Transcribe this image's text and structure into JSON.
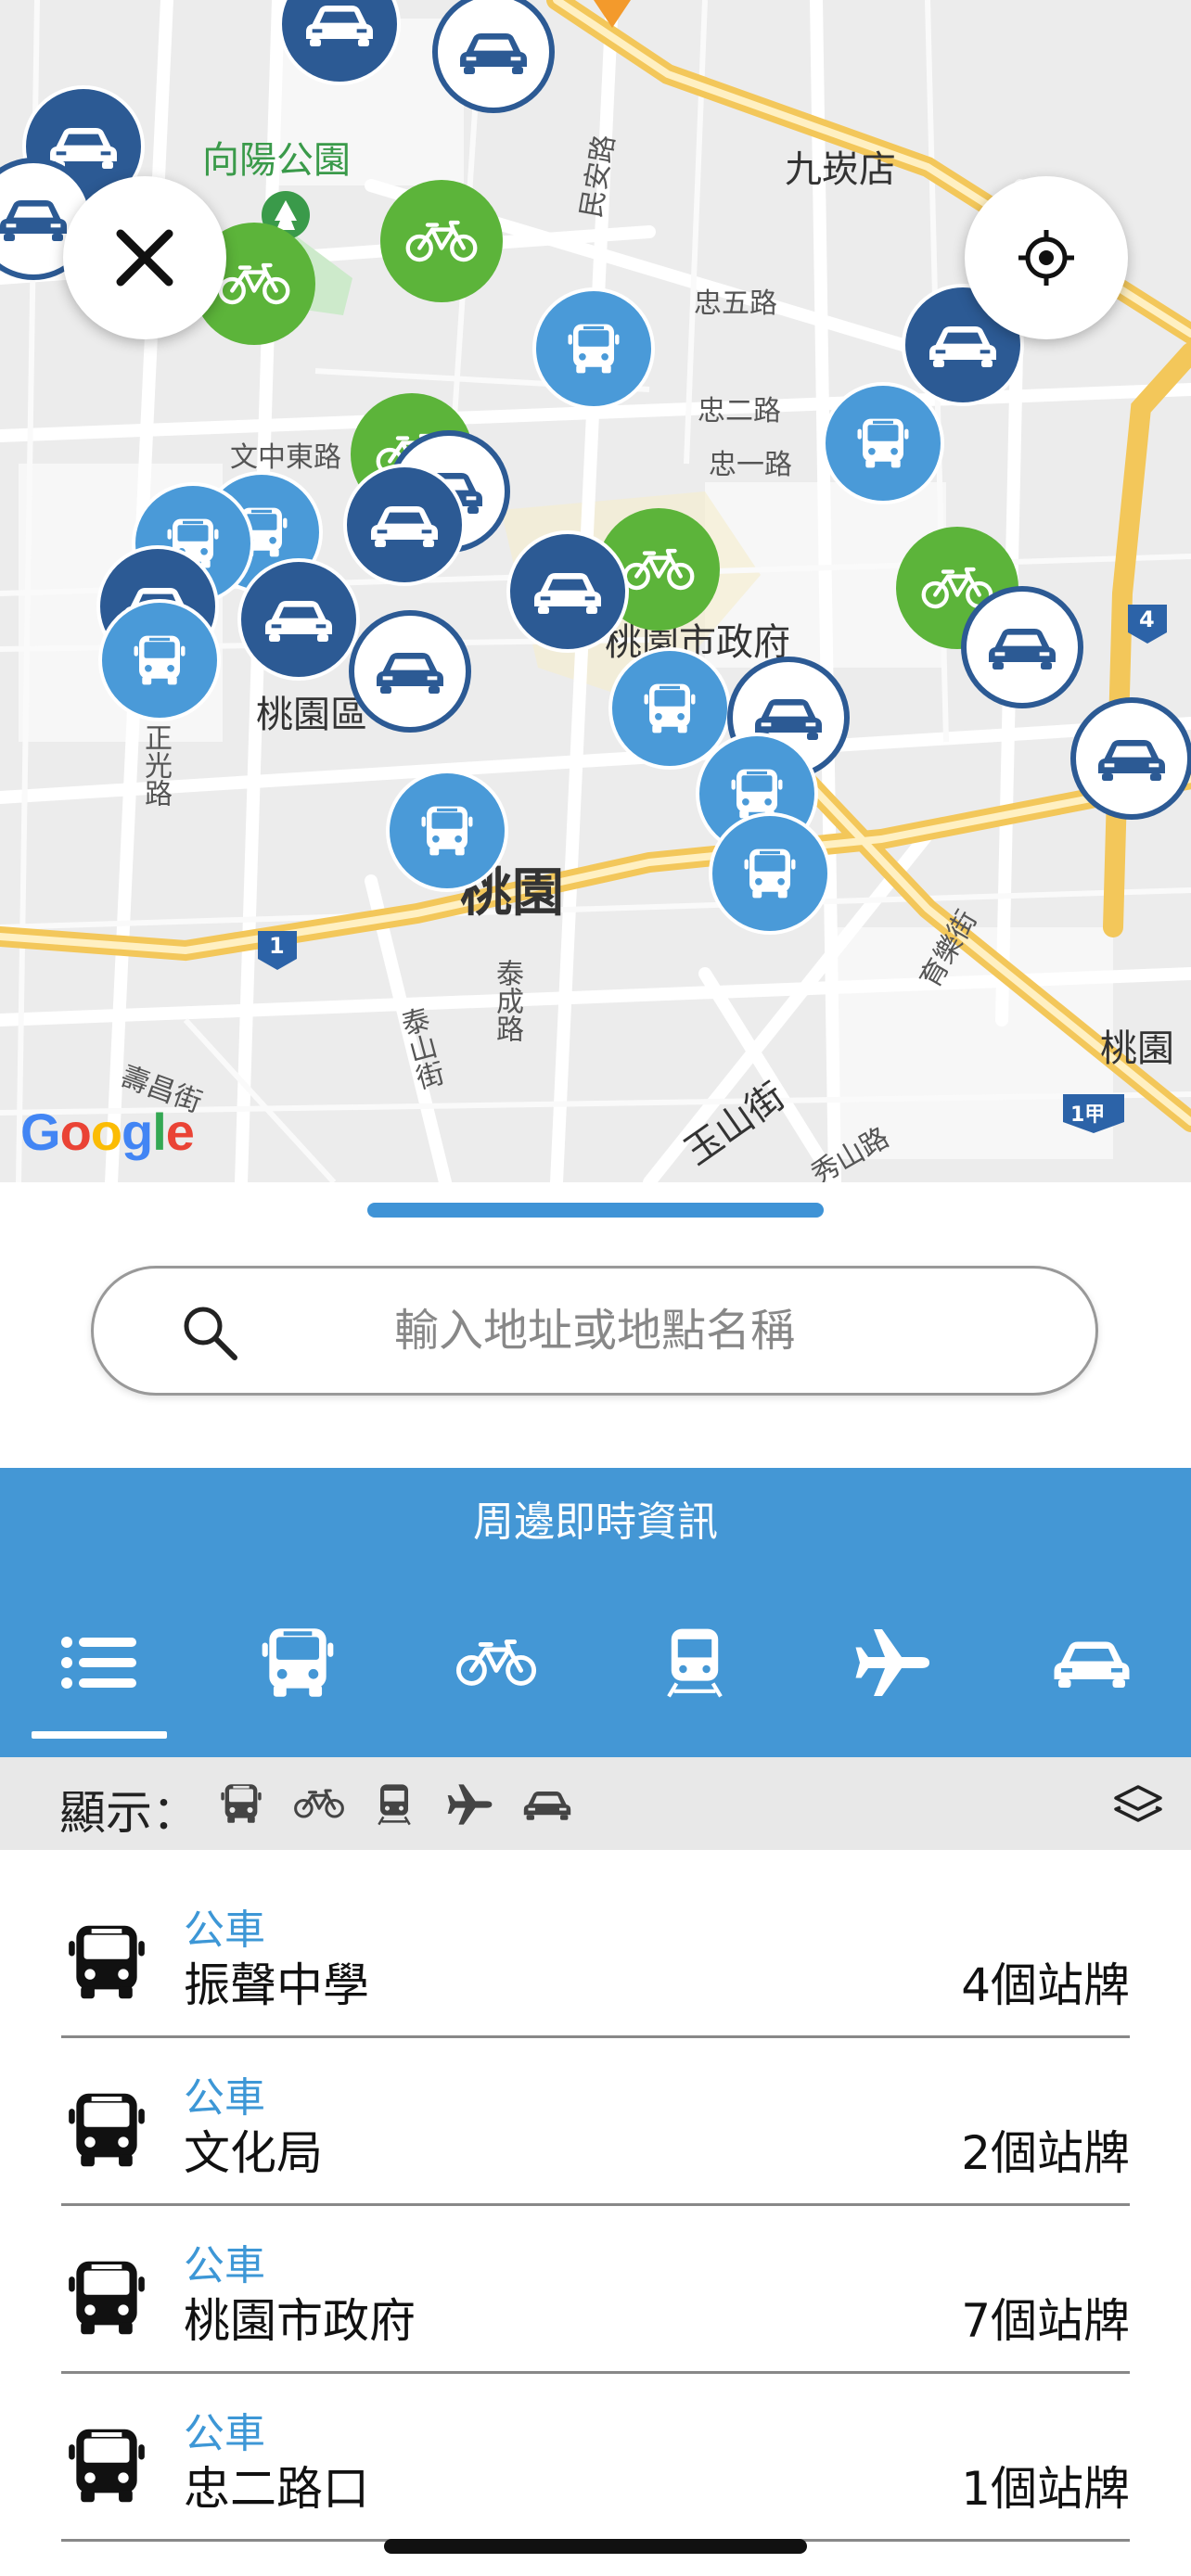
{
  "map": {
    "labels": {
      "park": "向陽公園",
      "jiukan": "九崁店",
      "minan": "民安路",
      "zhongwu": "忠五路",
      "zhonger": "忠二路",
      "zhongyi": "忠一路",
      "wenzhongdong": "文中東路",
      "cityhall": "桃園市政府",
      "taoyuanqu": "桃園區",
      "taoyuan": "桃園",
      "zhengguang": "正光路",
      "taicheng": "泰成路",
      "taishan": "泰山街",
      "yushan": "玉山街",
      "yule": "育樂街",
      "xiushan": "秀山路",
      "shouchang": "壽昌街",
      "route1": "1",
      "route1jia": "1甲",
      "route4": "4",
      "taoyuan_right": "桃園"
    },
    "google": "Google",
    "buttons": {
      "close_icon": "close-icon",
      "locate_icon": "locate-icon"
    }
  },
  "search": {
    "placeholder": "輸入地址或地點名稱",
    "icon": "search-icon"
  },
  "panel": {
    "title": "周邊即時資訊",
    "tabs": [
      {
        "icon": "list-icon",
        "selected": true
      },
      {
        "icon": "bus-icon",
        "selected": false
      },
      {
        "icon": "bike-icon",
        "selected": false
      },
      {
        "icon": "train-icon",
        "selected": false
      },
      {
        "icon": "plane-icon",
        "selected": false
      },
      {
        "icon": "car-icon",
        "selected": false
      }
    ]
  },
  "filter": {
    "label": "顯示：",
    "icons": [
      "bus-icon",
      "bike-icon",
      "train-icon",
      "plane-icon",
      "car-icon"
    ],
    "layers_icon": "layers-icon"
  },
  "results": [
    {
      "type": "公車",
      "name": "振聲中學",
      "count": "4個站牌"
    },
    {
      "type": "公車",
      "name": "文化局",
      "count": "2個站牌"
    },
    {
      "type": "公車",
      "name": "桃園市政府",
      "count": "7個站牌"
    },
    {
      "type": "公車",
      "name": "忠二路口",
      "count": "1個站牌"
    }
  ],
  "colors": {
    "bus": "#4a9ad8",
    "bike": "#5cb43a",
    "car": "#2c5a94",
    "panel": "#4497d5",
    "accent_text": "#3d97d6"
  }
}
